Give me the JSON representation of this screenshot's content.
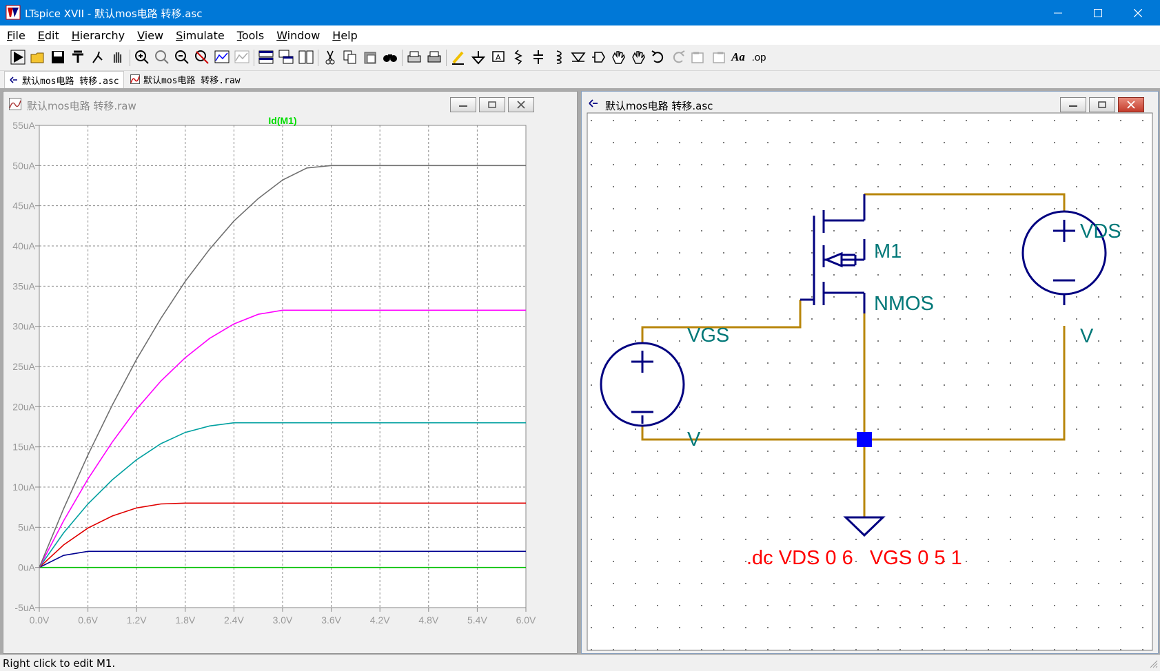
{
  "window": {
    "title": "LTspice XVII - 默认mos电路 转移.asc",
    "controls": [
      "minimize",
      "maximize",
      "close"
    ]
  },
  "menu": [
    {
      "label": "File",
      "accel": "F",
      "rest": "ile"
    },
    {
      "label": "Edit",
      "accel": "E",
      "rest": "dit"
    },
    {
      "label": "Hierarchy",
      "accel": "H",
      "rest": "ierarchy"
    },
    {
      "label": "View",
      "accel": "V",
      "rest": "iew"
    },
    {
      "label": "Simulate",
      "accel": "S",
      "rest": "imulate"
    },
    {
      "label": "Tools",
      "accel": "T",
      "rest": "ools"
    },
    {
      "label": "Window",
      "accel": "W",
      "rest": "indow"
    },
    {
      "label": "Help",
      "accel": "H",
      "rest": "elp"
    }
  ],
  "toolbar": {
    "icons": [
      "run-icon",
      "open-icon",
      "save-icon",
      "control-panel-icon",
      "halt-icon",
      "pan-hand-icon",
      "zoom-in-icon",
      "zoom-fit-icon",
      "zoom-out-icon",
      "zoom-cancel-icon",
      "autorange-icon",
      "mark-unconnected-icon",
      "tile-horizontal-icon",
      "cascade-icon",
      "tile-vertical-icon",
      "cut-icon",
      "copy-icon",
      "paste-icon",
      "find-icon",
      "print-setup-icon",
      "print-icon",
      "draw-wire-icon",
      "ground-icon",
      "label-net-icon",
      "resistor-icon",
      "capacitor-icon",
      "inductor-icon",
      "diode-icon",
      "component-icon",
      "move-icon",
      "drag-icon",
      "undo-icon",
      "redo-icon",
      "rotate-icon",
      "mirror-icon",
      "text-icon",
      "spice-directive-icon"
    ],
    "text_button": "Aa",
    "op_button": ".op"
  },
  "tabs": [
    {
      "label": "默认mos电路 转移.asc",
      "active": true
    },
    {
      "label": "默认mos电路 转移.raw",
      "active": false
    }
  ],
  "plot_window": {
    "title": "默认mos电路 转移.raw",
    "trace_label": "Id(M1)",
    "trace_label_color": "#00dd00"
  },
  "chart_data": {
    "type": "line",
    "title": "Id(M1)",
    "xlabel": "",
    "ylabel": "",
    "xlim": [
      0,
      6
    ],
    "ylim": [
      -5,
      55
    ],
    "x_ticks": [
      "0.0V",
      "0.6V",
      "1.2V",
      "1.8V",
      "2.4V",
      "3.0V",
      "3.6V",
      "4.2V",
      "4.8V",
      "5.4V",
      "6.0V"
    ],
    "y_ticks": [
      "55uA",
      "50uA",
      "45uA",
      "40uA",
      "35uA",
      "30uA",
      "25uA",
      "20uA",
      "15uA",
      "10uA",
      "5uA",
      "0uA",
      "-5uA"
    ],
    "grid": true,
    "x": [
      0,
      0.3,
      0.6,
      0.9,
      1.2,
      1.5,
      1.8,
      2.1,
      2.4,
      2.7,
      3.0,
      3.3,
      3.6,
      3.9,
      4.2,
      4.5,
      4.8,
      5.1,
      5.4,
      5.7,
      6.0
    ],
    "series": [
      {
        "color": "#00c000",
        "values": [
          0,
          0,
          0,
          0,
          0,
          0,
          0,
          0,
          0,
          0,
          0,
          0,
          0,
          0,
          0,
          0,
          0,
          0,
          0,
          0,
          0
        ]
      },
      {
        "color": "#000090",
        "values": [
          0,
          1.5,
          2.0,
          2.0,
          2.0,
          2.0,
          2.0,
          2.0,
          2.0,
          2.0,
          2.0,
          2.0,
          2.0,
          2.0,
          2.0,
          2.0,
          2.0,
          2.0,
          2.0,
          2.0,
          2.0
        ]
      },
      {
        "color": "#e00000",
        "values": [
          0,
          2.8,
          4.9,
          6.4,
          7.4,
          7.9,
          8.0,
          8.0,
          8.0,
          8.0,
          8.0,
          8.0,
          8.0,
          8.0,
          8.0,
          8.0,
          8.0,
          8.0,
          8.0,
          8.0,
          8.0
        ]
      },
      {
        "color": "#00a0a0",
        "values": [
          0,
          4.3,
          7.9,
          10.9,
          13.4,
          15.4,
          16.8,
          17.6,
          18.0,
          18.0,
          18.0,
          18.0,
          18.0,
          18.0,
          18.0,
          18.0,
          18.0,
          18.0,
          18.0,
          18.0,
          18.0
        ]
      },
      {
        "color": "#ff00ff",
        "values": [
          0,
          5.8,
          11.0,
          15.6,
          19.7,
          23.2,
          26.1,
          28.5,
          30.3,
          31.5,
          32.0,
          32.0,
          32.0,
          32.0,
          32.0,
          32.0,
          32.0,
          32.0,
          32.0,
          32.0,
          32.0
        ]
      },
      {
        "color": "#707070",
        "values": [
          0,
          7.3,
          14.0,
          20.2,
          25.9,
          31.0,
          35.6,
          39.6,
          43.1,
          45.9,
          48.2,
          49.7,
          50.0,
          50.0,
          50.0,
          50.0,
          50.0,
          50.0,
          50.0,
          50.0,
          50.0
        ]
      }
    ]
  },
  "schematic_window": {
    "title": "默认mos电路 转移.asc",
    "labels": {
      "m1": "M1",
      "nmos": "NMOS",
      "vds": "VDS",
      "vds_value": "V",
      "vgs": "VGS",
      "vgs_value": "V",
      "directive": ".dc VDS 0 6   VGS 0 5 1"
    },
    "colors": {
      "wire": "#b8860b",
      "component": "#000080",
      "label": "#007878",
      "directive": "#ff0000",
      "junction": "#0000ff"
    }
  },
  "status": "Right click to edit M1."
}
